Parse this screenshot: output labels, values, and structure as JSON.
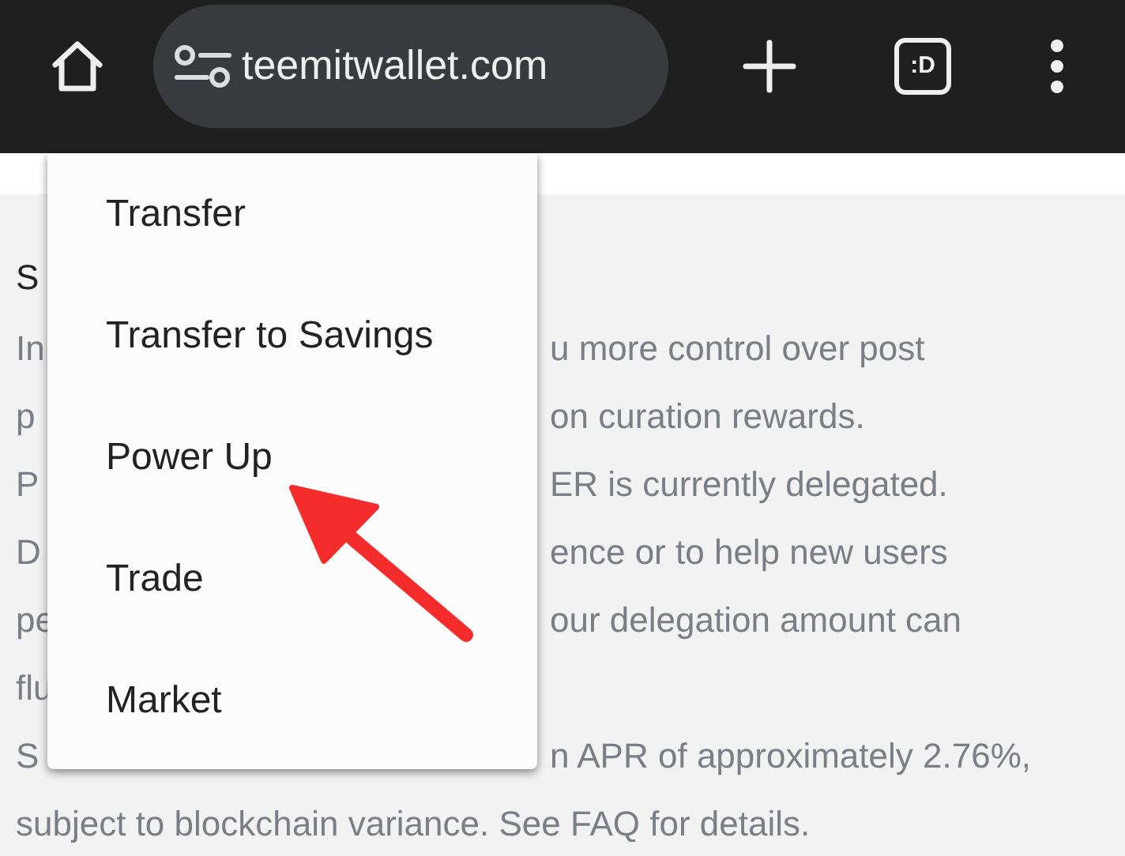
{
  "toolbar": {
    "url": "teemitwallet.com",
    "tab_switcher": ":D"
  },
  "page": {
    "heading": "S",
    "lines": [
      {
        "left": "In",
        "right": "u more control over post"
      },
      {
        "left": "p",
        "right": "on curation rewards."
      },
      {
        "left": "P",
        "right": "ER is currently delegated."
      },
      {
        "left": "D",
        "right": "ence or to help new users"
      },
      {
        "left": "pe",
        "right": "our delegation amount can"
      },
      {
        "left": "flu"
      },
      {
        "left": "S",
        "right": "n APR of approximately 2.76%,"
      },
      {
        "left": "subject to blockchain variance. See FAQ for details."
      }
    ]
  },
  "menu": {
    "items": [
      "Transfer",
      "Transfer to Savings",
      "Power Up",
      "Trade",
      "Market"
    ]
  }
}
